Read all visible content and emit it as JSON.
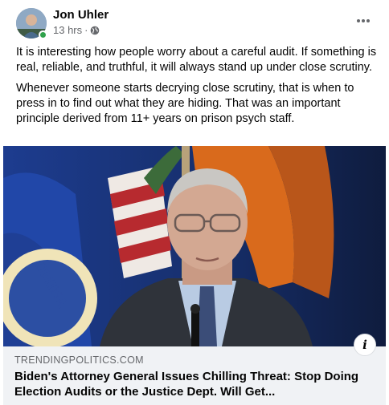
{
  "post": {
    "author": "Jon Uhler",
    "timestamp": "13 hrs",
    "separator": "·",
    "privacy_icon": "globe-icon",
    "more_icon": "more-horizontal-icon",
    "paragraphs": [
      "It is interesting how people worry about a careful audit. If something is real, reliable, and truthful, it will always stand up under close scrutiny.",
      "Whenever someone starts decrying close scrutiny, that is when to press in to find out what they are hiding. That was an important principle derived from 11+ years on prison psych staff."
    ]
  },
  "link_preview": {
    "domain": "TRENDINGPOLITICS.COM",
    "headline": "Biden's Attorney General Issues Chilling Threat: Stop Doing Election Audits or the Justice Dept. Will Get...",
    "info_label": "i"
  },
  "colors": {
    "online": "#31a24c",
    "secondary_text": "#65676b",
    "preview_bg": "#f0f2f5"
  }
}
